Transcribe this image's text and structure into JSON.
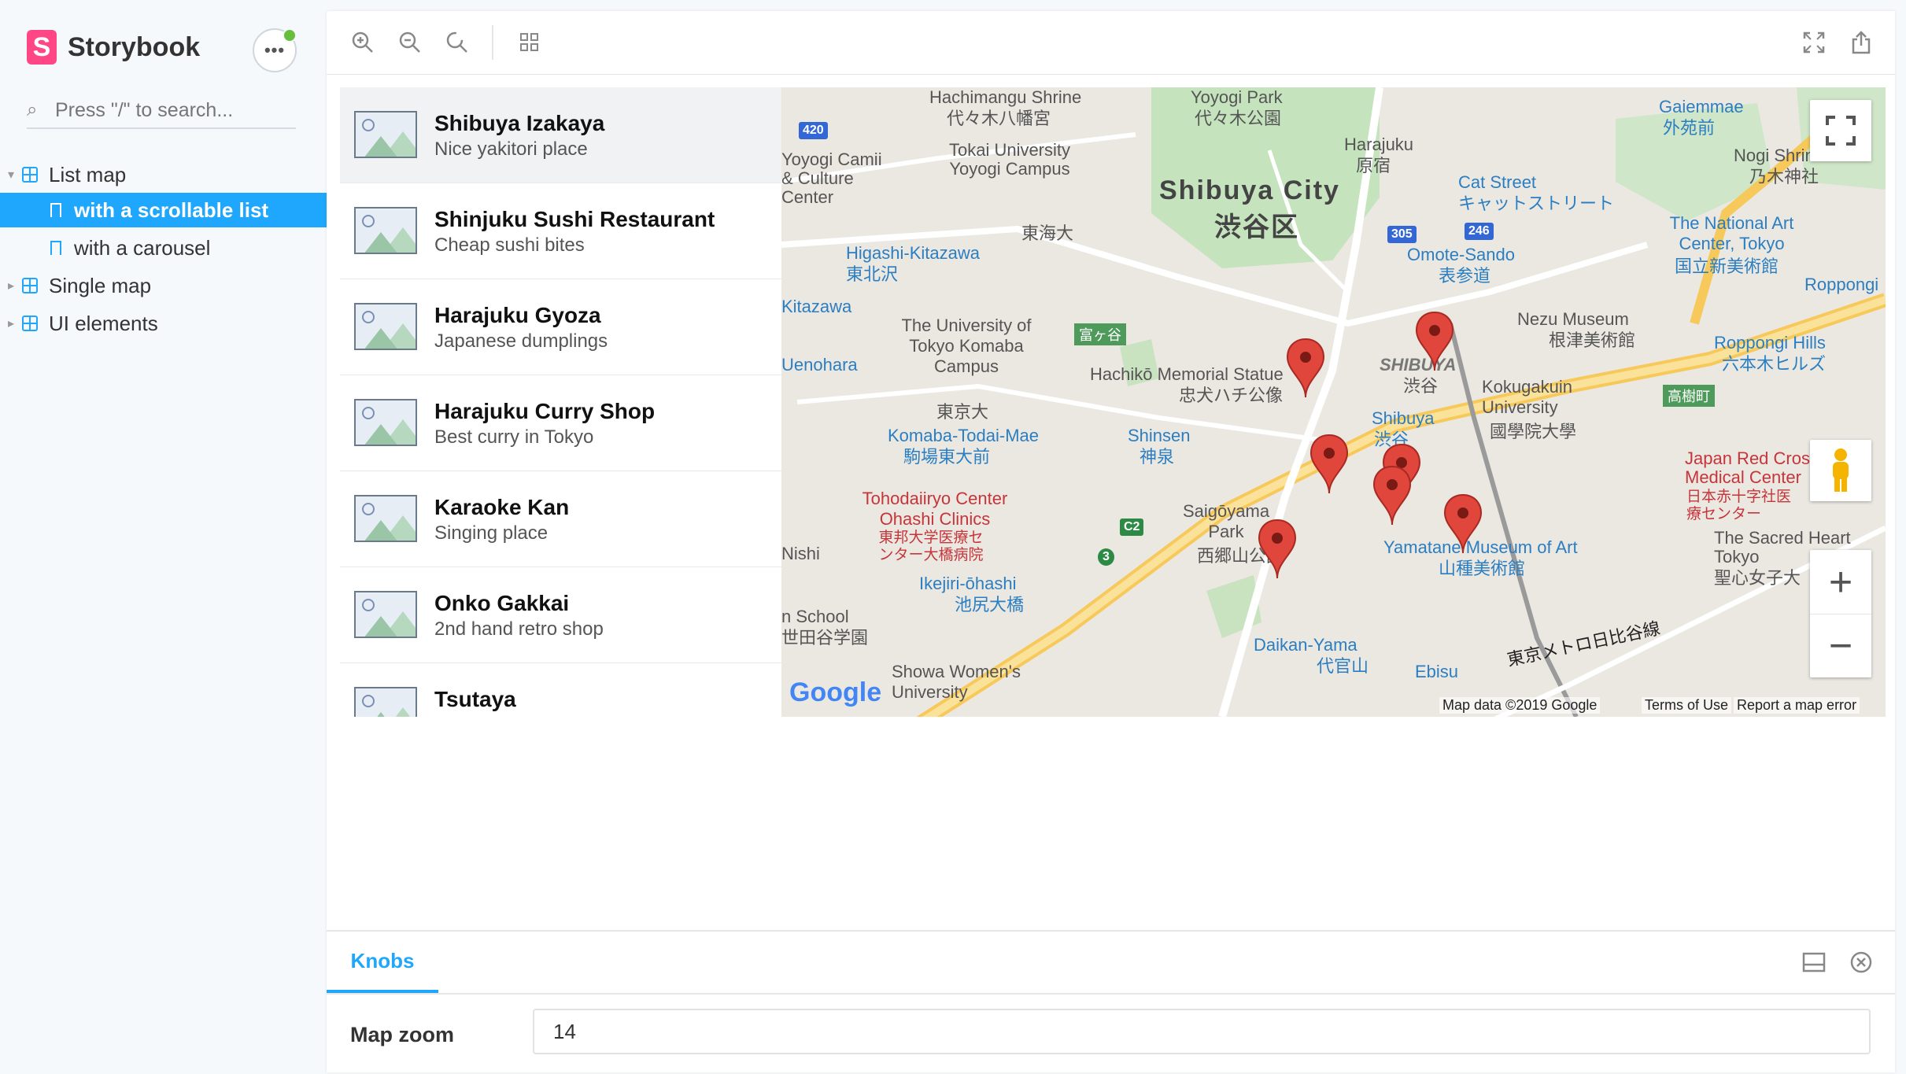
{
  "sidebar": {
    "brand": "Storybook",
    "menu_label": "•••",
    "search_placeholder": "Press \"/\" to search...",
    "items": [
      {
        "label": "List map"
      },
      {
        "label": "with a scrollable list"
      },
      {
        "label": "with a carousel"
      },
      {
        "label": "Single map"
      },
      {
        "label": "UI elements"
      }
    ]
  },
  "toolbar": {
    "zoom_in": "zoom-in-icon",
    "zoom_out": "zoom-out-icon",
    "reset": "reset-zoom-icon",
    "grid": "grid-icon",
    "fullscreen": "fullscreen-icon",
    "share": "share-icon"
  },
  "places": [
    {
      "name": "Shibuya Izakaya",
      "desc": "Nice yakitori place"
    },
    {
      "name": "Shinjuku Sushi Restaurant",
      "desc": "Cheap sushi bites"
    },
    {
      "name": "Harajuku Gyoza",
      "desc": "Japanese dumplings"
    },
    {
      "name": "Harajuku Curry Shop",
      "desc": "Best curry in Tokyo"
    },
    {
      "name": "Karaoke Kan",
      "desc": "Singing place"
    },
    {
      "name": "Onko Gakkai",
      "desc": "2nd hand retro shop"
    },
    {
      "name": "Tsutaya",
      "desc": ""
    }
  ],
  "map": {
    "labels": [
      "Hachimangu Shrine",
      "代々木八幡宮",
      "Yoyogi Park",
      "代々木公園",
      "Harajuku",
      "原宿",
      "Shibuya City",
      "渋谷区",
      "Cat Street",
      "キャットストリート",
      "Omote-Sando",
      "表参道",
      "Nezu Museum",
      "根津美術館",
      "Tokai University Yoyogi Campus",
      "東海大",
      "Higashi-Kitazawa",
      "東北沢",
      "The University of Tokyo Komaba Campus",
      "東京大",
      "Hachikō Memorial Statue",
      "忠犬ハチ公像",
      "SHIBUYA",
      "渋谷",
      "Shibuya",
      "渋谷",
      "Kokugakuin University",
      "國學院大學",
      "Komaba-Todai-Mae",
      "駒場東大前",
      "Shinsen",
      "神泉",
      "Tohodaiiryo Center Ohashi Clinics",
      "東邦大学医療センター大橋病院",
      "Saigōyama Park",
      "西郷山公園",
      "Ikejiri-ōhashi",
      "池尻大橋",
      "Yamatane Museum of Art",
      "山種美術館",
      "Daikan-Yama",
      "代官山",
      "Ebisu",
      "Showa Women's University",
      "Gaiemmae",
      "外苑前",
      "The National Art Center, Tokyo",
      "国立新美術館",
      "Roppongi Hills",
      "六本木ヒルズ",
      "Japan Red Cross Medical Center",
      "日本赤十字社医療センター",
      "The Sacred Heart",
      "Tokyo",
      "聖心女子大",
      "Nogi Shrine",
      "乃木神社",
      "Roppongi",
      "Yoyogi Camii & Culture Center",
      "富ヶ谷",
      "高樹町",
      "東京メトロ日比谷線",
      "Kitazawa",
      "Uenohara",
      "n School",
      "世田谷学園",
      "Nishi"
    ],
    "road_signs": [
      "420",
      "305",
      "246",
      "C2",
      "3"
    ],
    "markers": 8,
    "attribution": "Map data ©2019 Google",
    "terms": "Terms of Use",
    "report": "Report a map error",
    "google": "Google"
  },
  "addons": {
    "tab": "Knobs",
    "knob_label": "Map zoom",
    "knob_value": "14"
  }
}
